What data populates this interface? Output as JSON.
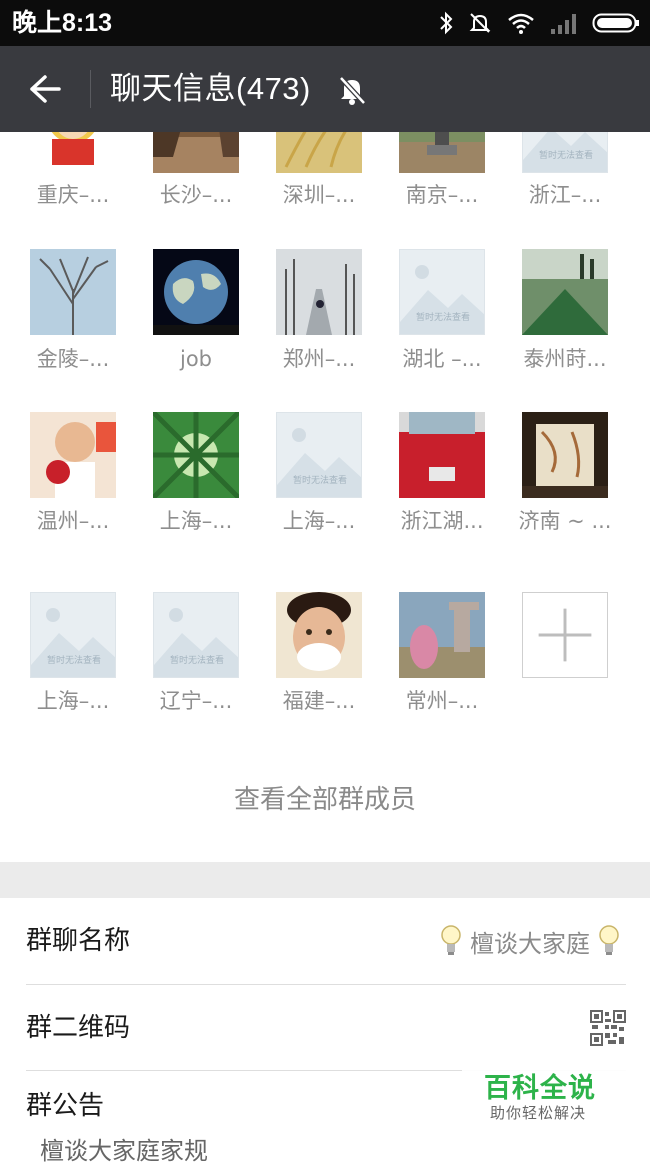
{
  "status_bar": {
    "time": "晚上8:13",
    "icons": [
      "bluetooth-icon",
      "silent-bell-icon",
      "wifi-icon",
      "signal-icon",
      "battery-icon"
    ]
  },
  "nav": {
    "title": "聊天信息(473)",
    "back_icon": "back-arrow-icon",
    "mute_icon": "mute-bell-icon"
  },
  "placeholder_caption": "暂时无法查看",
  "members": [
    {
      "name": "重庆–...",
      "avatar": "cartoon-girl"
    },
    {
      "name": "长沙–...",
      "avatar": "brown-street"
    },
    {
      "name": "深圳–...",
      "avatar": "wheat-sky"
    },
    {
      "name": "南京–...",
      "avatar": "park-statue"
    },
    {
      "name": "浙江–...",
      "avatar": "placeholder"
    },
    {
      "name": "金陵–...",
      "avatar": "bare-tree"
    },
    {
      "name": "job",
      "avatar": "earth-night"
    },
    {
      "name": "郑州–...",
      "avatar": "snow-road"
    },
    {
      "name": "湖北 –...",
      "avatar": "placeholder"
    },
    {
      "name": "泰州莳...",
      "avatar": "tent-forest"
    },
    {
      "name": "温州–...",
      "avatar": "child-flowers"
    },
    {
      "name": "上海–...",
      "avatar": "bamboo"
    },
    {
      "name": "上海–...",
      "avatar": "placeholder"
    },
    {
      "name": "浙江湖...",
      "avatar": "red-car"
    },
    {
      "name": "济南 ~ ...",
      "avatar": "room-interior"
    },
    {
      "name": "上海–...",
      "avatar": "placeholder"
    },
    {
      "name": "辽宁–...",
      "avatar": "placeholder"
    },
    {
      "name": "福建–...",
      "avatar": "shaving-man"
    },
    {
      "name": "常州–...",
      "avatar": "outdoor-statue"
    }
  ],
  "add_member_icon": "plus-icon",
  "view_all": "查看全部群成员",
  "settings": {
    "group_name_label": "群聊名称",
    "group_name_value": "檀谈大家庭",
    "qr_label": "群二维码",
    "announcement_label": "群公告",
    "announcement_text": "檀谈大家庭家规"
  },
  "watermark": {
    "title": "百科全说",
    "subtitle": "助你轻松解决"
  },
  "colors": {
    "status_bar_bg": "#0c0c0c",
    "nav_bar_bg": "#393a3f",
    "gray_text": "#8e8e8e",
    "watermark_green": "#2db34a"
  }
}
